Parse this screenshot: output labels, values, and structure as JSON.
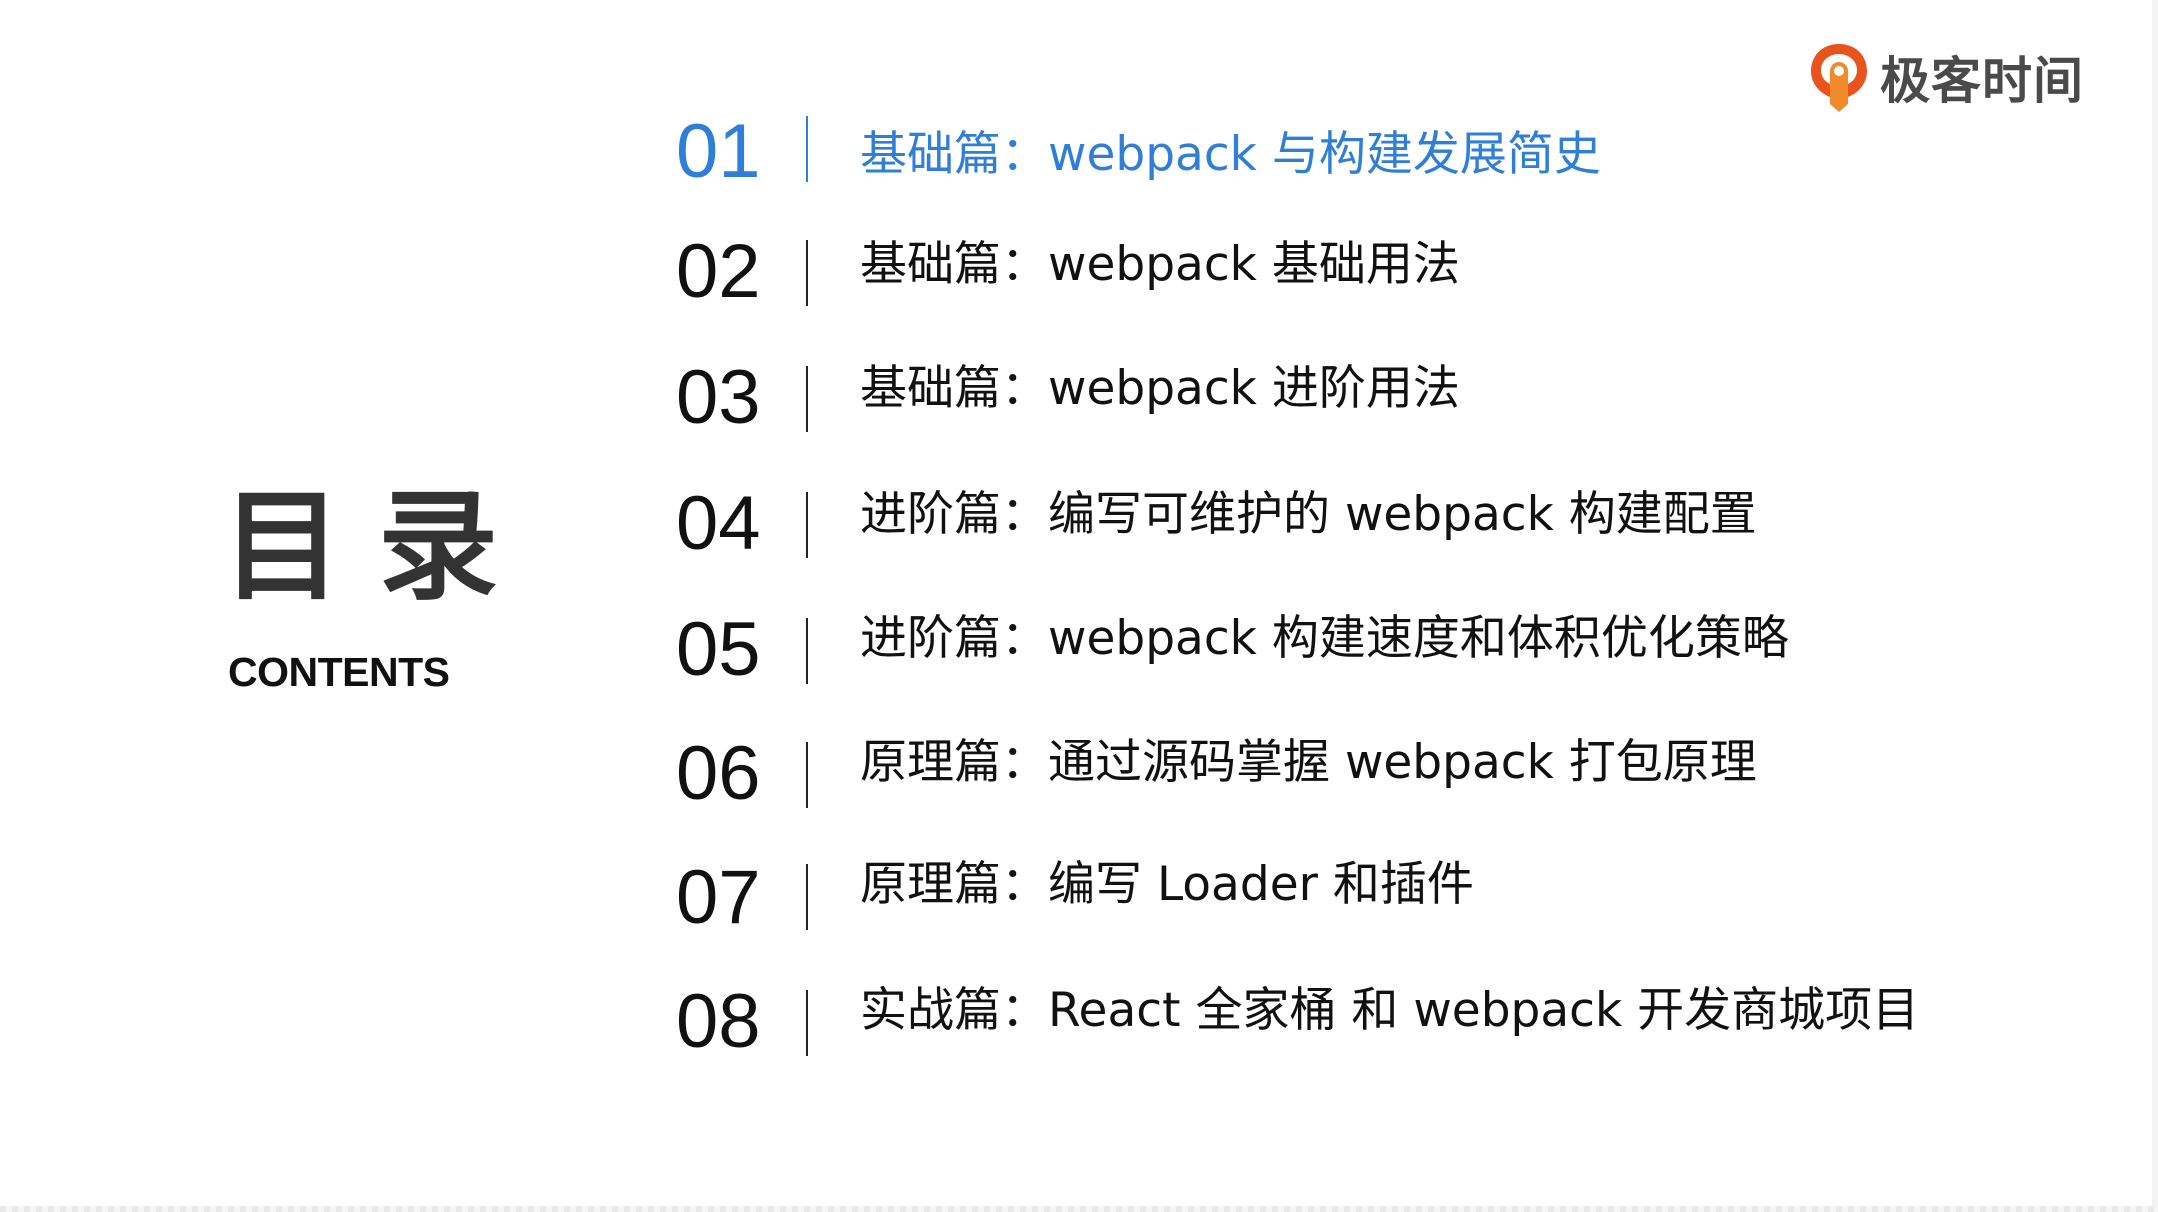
{
  "logo": {
    "text": "极客时间",
    "icon": "geekbang-logo-icon",
    "color": "#e8541c"
  },
  "title": "目录",
  "subtitle": "CONTENTS",
  "accent_color": "#2f7fd8",
  "items": [
    {
      "num": "01",
      "label": "基础篇：webpack 与构建发展简史",
      "active": true
    },
    {
      "num": "02",
      "label": "基础篇：webpack 基础用法",
      "active": false
    },
    {
      "num": "03",
      "label": "基础篇：webpack 进阶用法",
      "active": false
    },
    {
      "num": "04",
      "label": "进阶篇：编写可维护的 webpack 构建配置",
      "active": false
    },
    {
      "num": "05",
      "label": "进阶篇：webpack 构建速度和体积优化策略",
      "active": false
    },
    {
      "num": "06",
      "label": "原理篇：通过源码掌握 webpack 打包原理",
      "active": false
    },
    {
      "num": "07",
      "label": "原理篇：编写 Loader 和插件",
      "active": false
    },
    {
      "num": "08",
      "label": "实战篇：React 全家桶 和 webpack 开发商城项目",
      "active": false
    }
  ]
}
